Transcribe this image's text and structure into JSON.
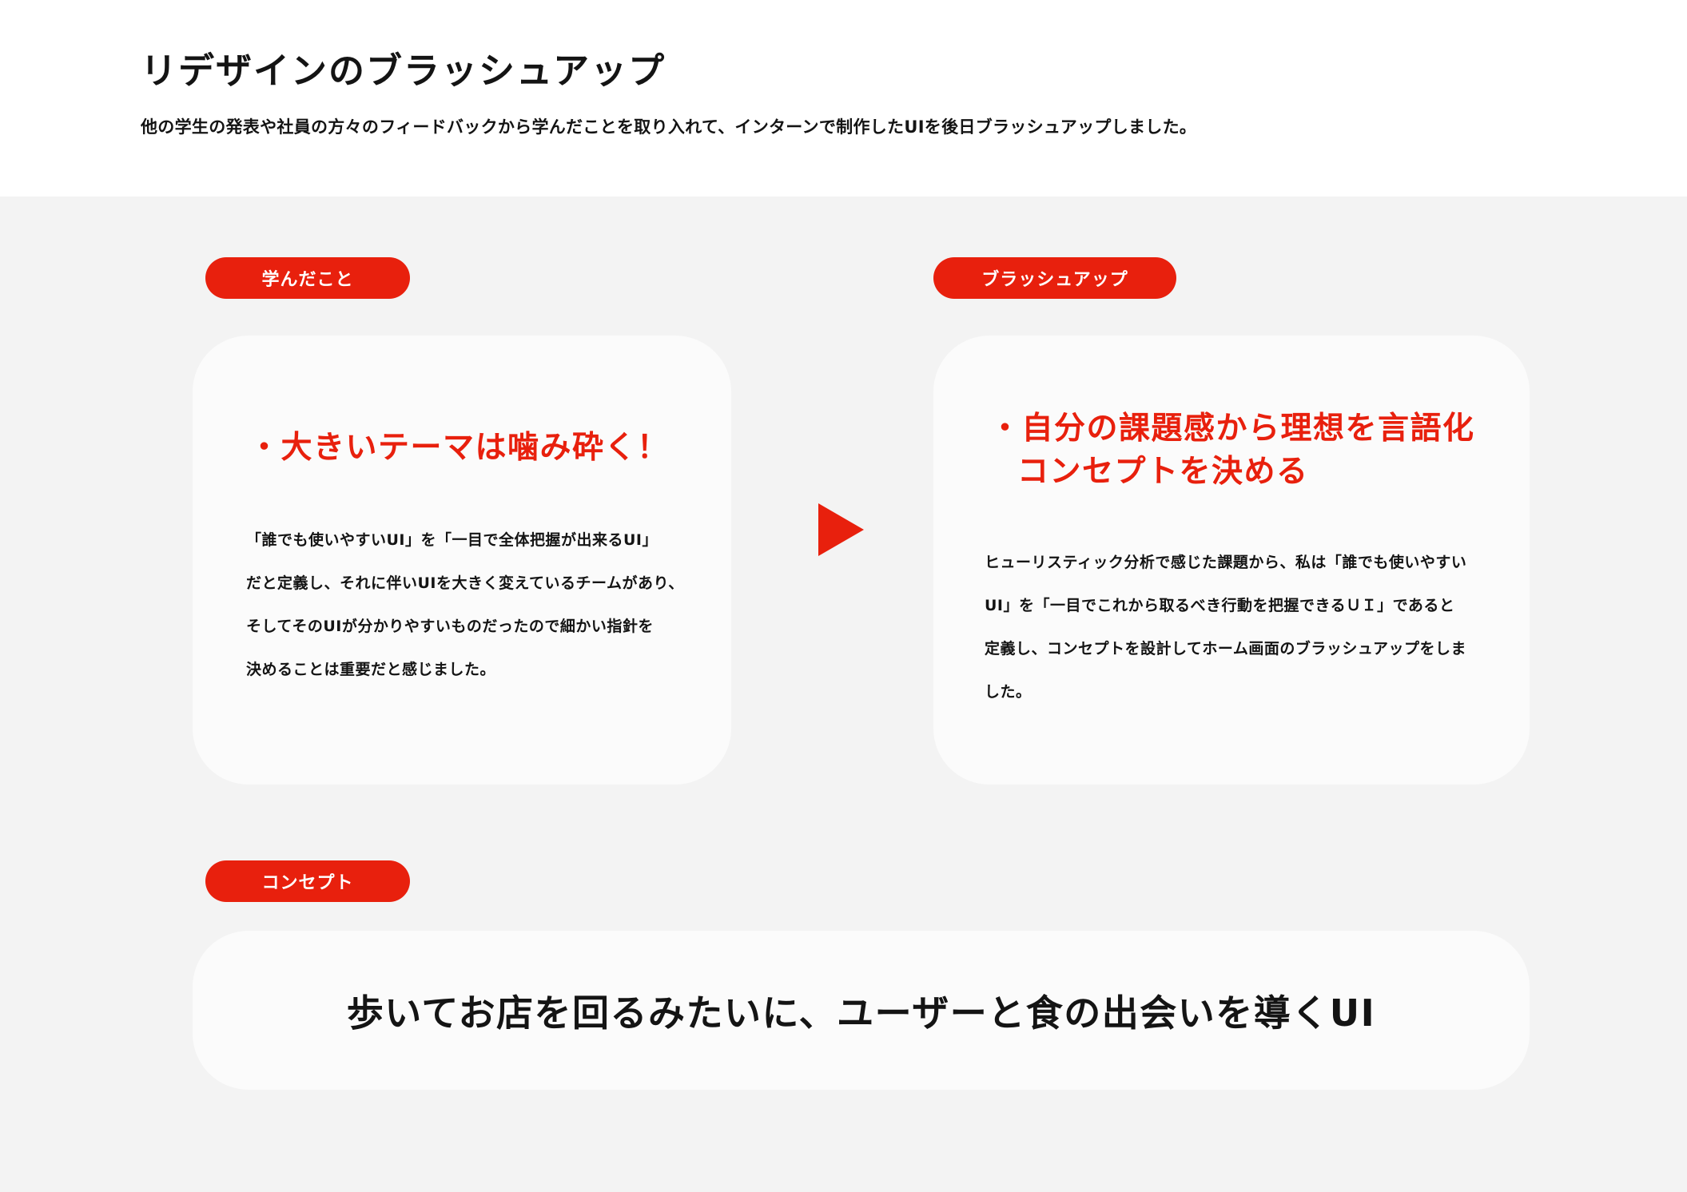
{
  "header": {
    "title": "リデザインのブラッシュアップ",
    "subtitle": "他の学生の発表や社員の方々のフィードバックから学んだことを取り入れて、インターンで制作したUIを後日ブラッシュアップしました。"
  },
  "learned": {
    "label": "学んだこと",
    "heading": "・大きいテーマは噛み砕く！",
    "body": [
      "「誰でも使いやすいUI」を「一目で全体把握が出来るUI」",
      "だと定義し、それに伴いUIを大きく変えているチームがあり、",
      "そしてそのUIが分かりやすいものだったので細かい指針を",
      "決めることは重要だと感じました。"
    ]
  },
  "brushup": {
    "label": "ブラッシュアップ",
    "heading_line1": "・自分の課題感から理想を言語化",
    "heading_line2": "コンセプトを決める",
    "body": [
      "ヒューリスティック分析で感じた課題から、私は「誰でも使いやすい",
      "UI」を「一目でこれから取るべき行動を把握できるＵＩ」であると",
      "定義し、コンセプトを設計してホーム画面のブラッシュアップをしま",
      "した。"
    ]
  },
  "concept": {
    "label": "コンセプト",
    "text": "歩いてお店を回るみたいに、ユーザーと食の出会いを導くUI"
  },
  "colors": {
    "accent": "#e8200d",
    "background": "#f3f3f3",
    "card": "#fbfbfb"
  },
  "icons": {
    "arrow": "play-arrow-right"
  }
}
